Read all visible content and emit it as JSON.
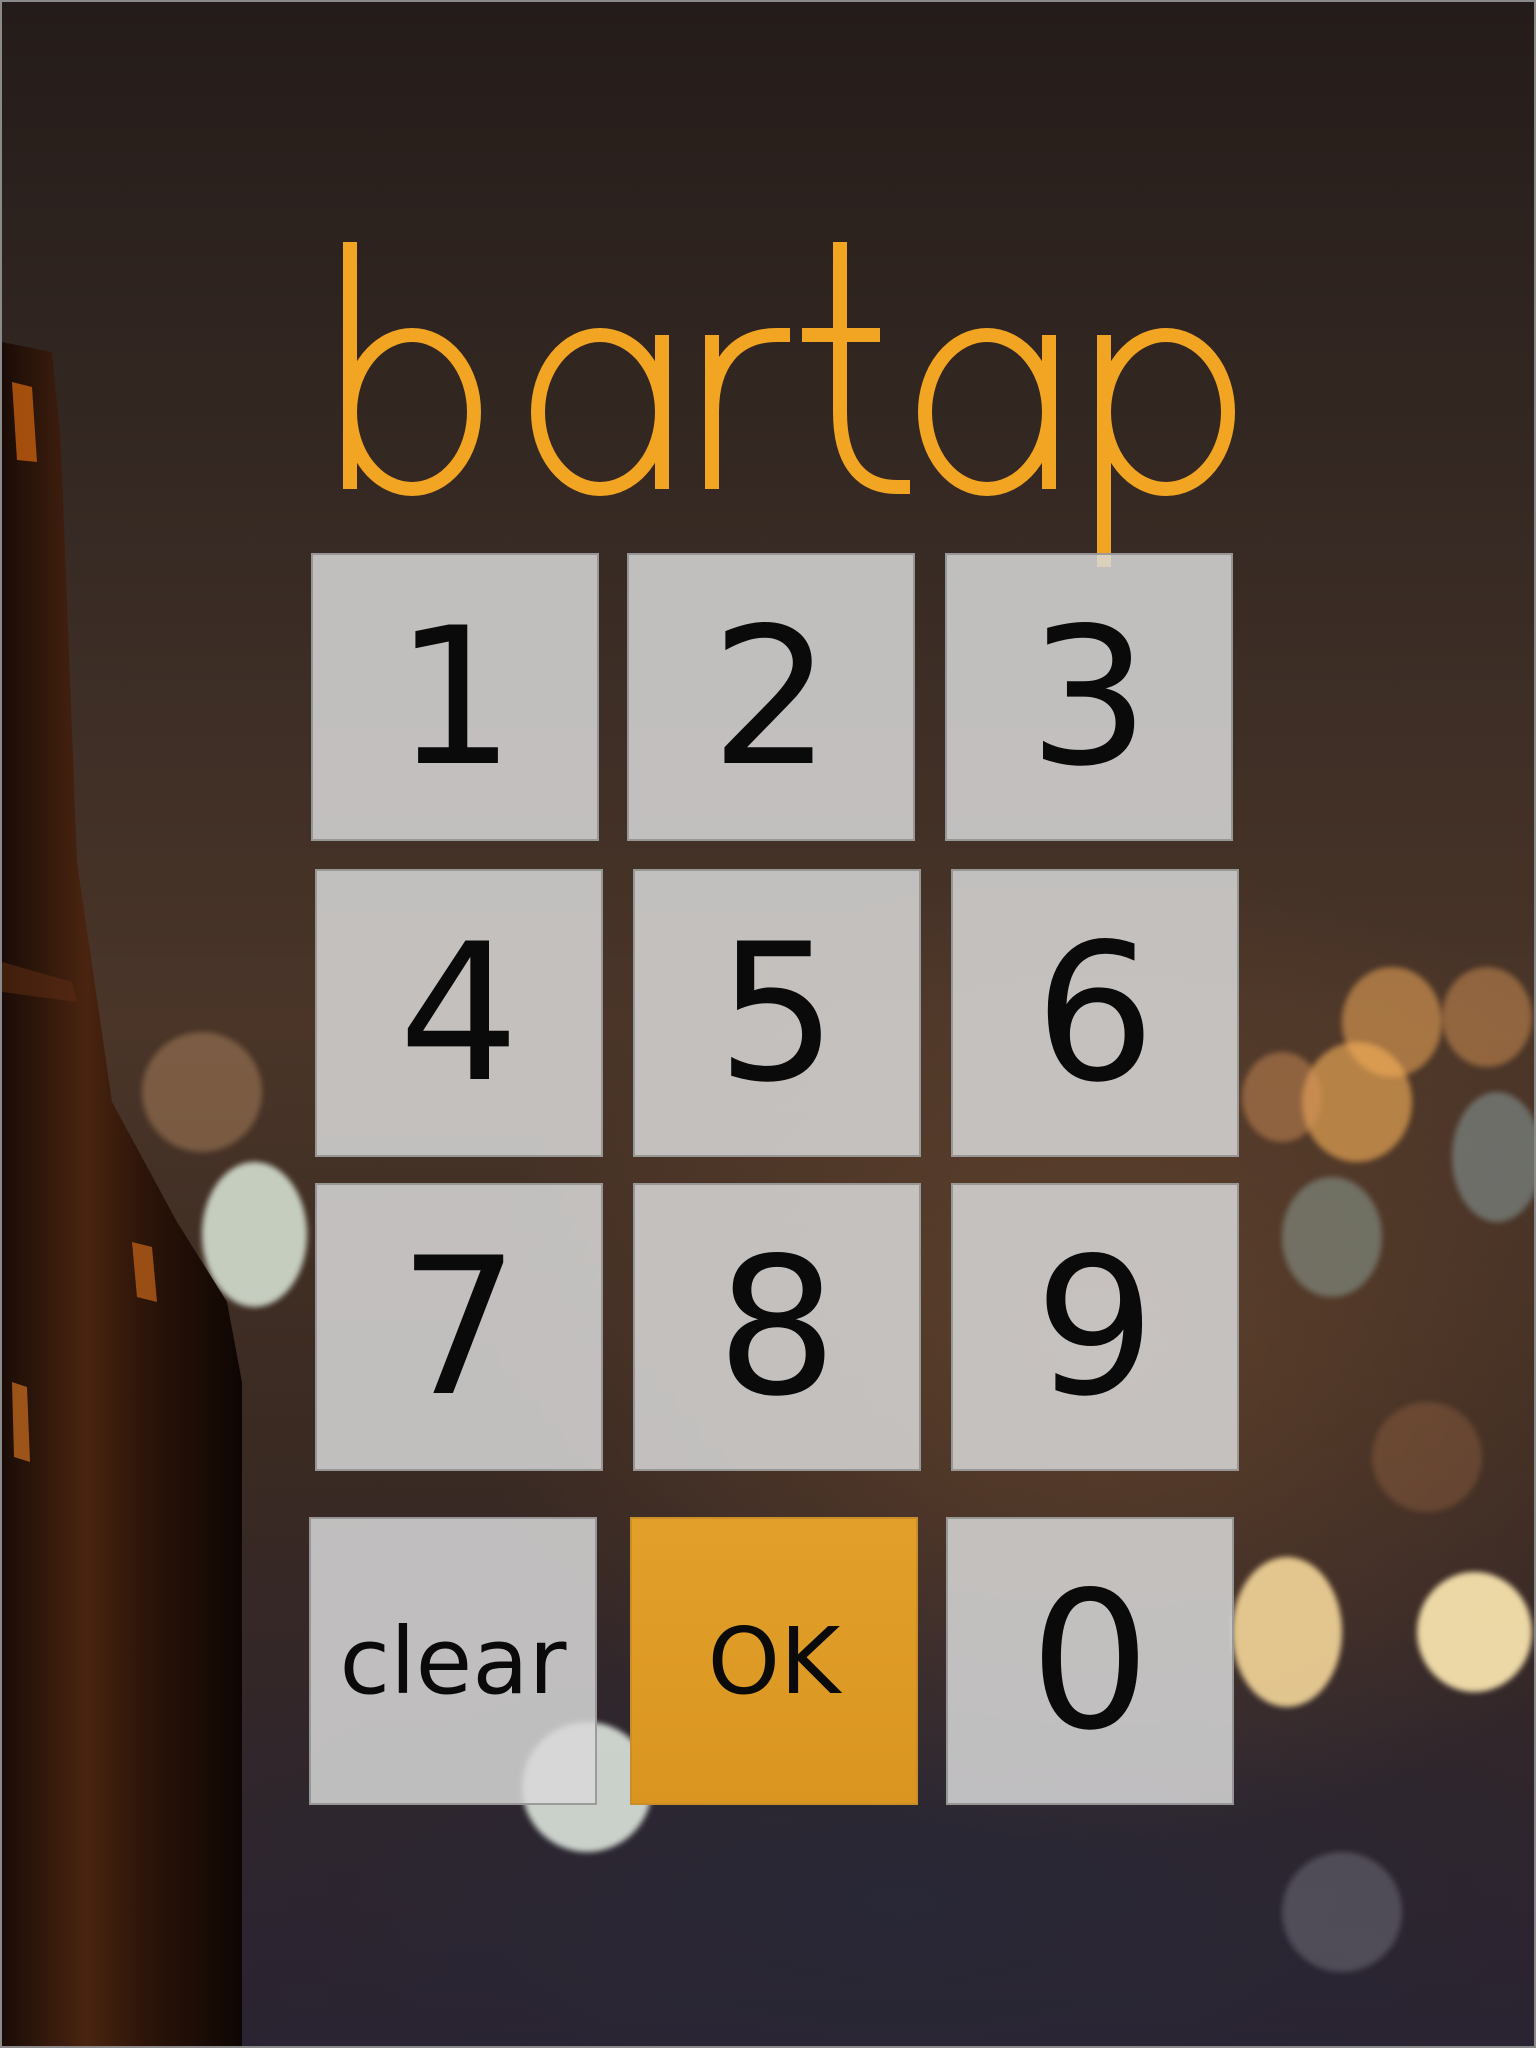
{
  "app": {
    "logo_text": "bartap",
    "accent_color": "#f2a423"
  },
  "keypad": {
    "keys": [
      {
        "label": "1",
        "name": "key-1"
      },
      {
        "label": "2",
        "name": "key-2"
      },
      {
        "label": "3",
        "name": "key-3"
      },
      {
        "label": "4",
        "name": "key-4"
      },
      {
        "label": "5",
        "name": "key-5"
      },
      {
        "label": "6",
        "name": "key-6"
      },
      {
        "label": "7",
        "name": "key-7"
      },
      {
        "label": "8",
        "name": "key-8"
      },
      {
        "label": "9",
        "name": "key-9"
      },
      {
        "label": "clear",
        "name": "clear-button"
      },
      {
        "label": "OK",
        "name": "ok-button"
      },
      {
        "label": "0",
        "name": "key-0"
      }
    ],
    "key_color": "#d7d7d7",
    "ok_color": "#e2a02a"
  }
}
